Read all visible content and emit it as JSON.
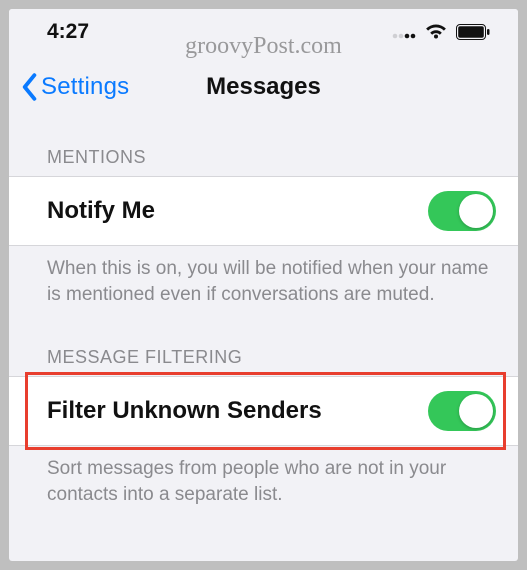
{
  "watermark": "groovyPost.com",
  "status_bar": {
    "time": "4:27"
  },
  "nav": {
    "back_label": "Settings",
    "title": "Messages"
  },
  "sections": {
    "mentions": {
      "header": "MENTIONS",
      "row_label": "Notify Me",
      "toggle_on": true,
      "footer": "When this is on, you will be notified when your name is mentioned even if conversations are muted."
    },
    "filtering": {
      "header": "MESSAGE FILTERING",
      "row_label": "Filter Unknown Senders",
      "toggle_on": true,
      "footer": "Sort messages from people who are not in your contacts into a separate list."
    }
  }
}
